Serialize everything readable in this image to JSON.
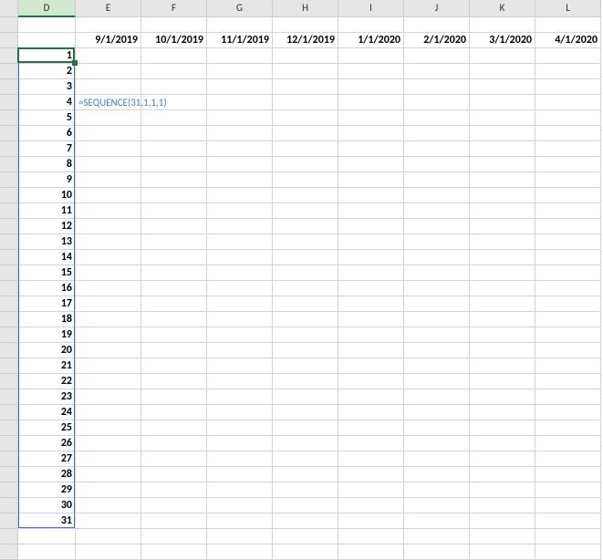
{
  "columns": [
    "",
    "D",
    "E",
    "F",
    "G",
    "H",
    "I",
    "J",
    "K",
    "L"
  ],
  "selected_column_index": 1,
  "header_row_dates": [
    "9/1/2019",
    "10/1/2019",
    "11/1/2019",
    "12/1/2019",
    "1/1/2020",
    "2/1/2020",
    "3/1/2020",
    "4/1/2020"
  ],
  "sequence_values": [
    "1",
    "2",
    "3",
    "4",
    "5",
    "6",
    "7",
    "8",
    "9",
    "10",
    "11",
    "12",
    "13",
    "14",
    "15",
    "16",
    "17",
    "18",
    "19",
    "20",
    "21",
    "22",
    "23",
    "24",
    "25",
    "26",
    "27",
    "28",
    "29",
    "30",
    "31"
  ],
  "formula_text": "=SEQUENCE(31,1,1,1)",
  "chart_data": null
}
